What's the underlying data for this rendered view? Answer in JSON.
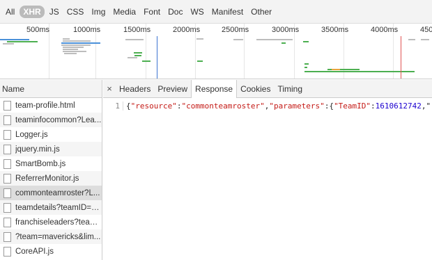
{
  "filters": [
    "All",
    "XHR",
    "JS",
    "CSS",
    "Img",
    "Media",
    "Font",
    "Doc",
    "WS",
    "Manifest",
    "Other"
  ],
  "active_filter": "XHR",
  "timeline": {
    "ticks": [
      "500ms",
      "1000ms",
      "1500ms",
      "2000ms",
      "2500ms",
      "3000ms",
      "3500ms",
      "4000ms",
      "450"
    ]
  },
  "requests": {
    "header": "Name",
    "items": [
      "team-profile.html",
      "teaminfocommon?Lea...",
      "Logger.js",
      "jquery.min.js",
      "SmartBomb.js",
      "ReferrerMonitor.js",
      "commonteamroster?L...",
      "teamdetails?teamID=1...",
      "franchiseleaders?team...",
      "?team=mavericks&lim...",
      "CoreAPI.js"
    ],
    "selected_index": 6
  },
  "detail": {
    "close_symbol": "×",
    "tabs": [
      "Headers",
      "Preview",
      "Response",
      "Cookies",
      "Timing"
    ],
    "active_tab": "Response",
    "line_number": "1",
    "response_tokens": [
      {
        "t": "{",
        "k": "p"
      },
      {
        "t": "\"resource\"",
        "k": "s"
      },
      {
        "t": ":",
        "k": "p"
      },
      {
        "t": "\"commonteamroster\"",
        "k": "s"
      },
      {
        "t": ",",
        "k": "p"
      },
      {
        "t": "\"parameters\"",
        "k": "s"
      },
      {
        "t": ":{",
        "k": "p"
      },
      {
        "t": "\"TeamID\"",
        "k": "s"
      },
      {
        "t": ":",
        "k": "p"
      },
      {
        "t": "1610612742",
        "k": "n"
      },
      {
        "t": ",\"",
        "k": "p"
      }
    ]
  },
  "colors": {
    "filter_active": "#bbbbbb",
    "string": "#c41a16",
    "number": "#1c00cf",
    "bar_green": "#4caf50",
    "bar_blue": "#4a90d9",
    "bar_gray": "#bdbdbd",
    "bar_orange": "#e8a33c",
    "marker_blue": "#3b73d1",
    "marker_red": "#e15353"
  }
}
